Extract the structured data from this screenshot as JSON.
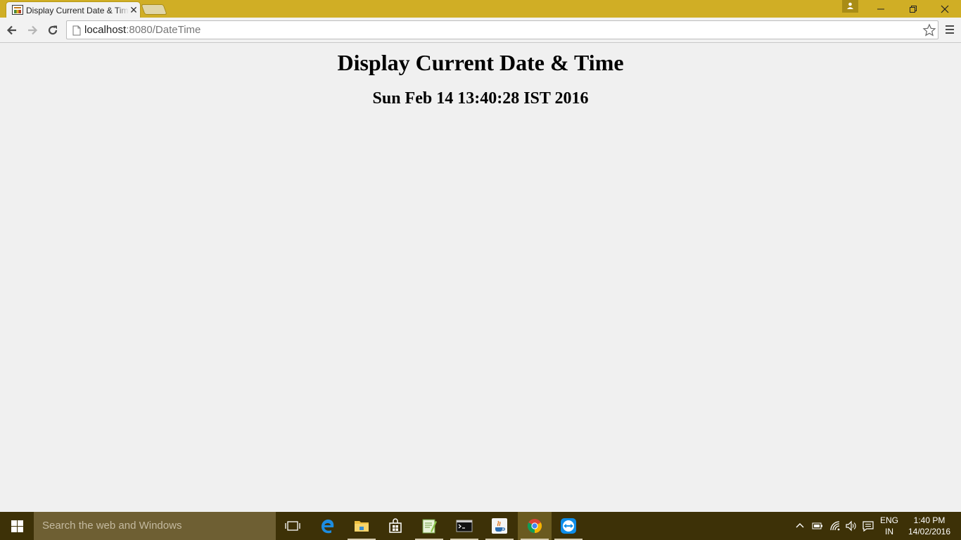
{
  "browser": {
    "tab": {
      "title": "Display Current Date & Time",
      "close_glyph": "✕",
      "favicon": "applet-chart-icon"
    },
    "omnibox": {
      "url_host": "localhost",
      "url_rest": ":8080/DateTime"
    },
    "theme_color": "#d0ae25"
  },
  "page": {
    "heading": "Display Current Date & Time",
    "datetime": "Sun Feb 14 13:40:28 IST 2016"
  },
  "taskbar": {
    "search_placeholder": "Search the web and Windows",
    "apps": [
      "task-view",
      "edge",
      "file-explorer",
      "store",
      "notepad++",
      "command-prompt",
      "java",
      "chrome",
      "teamviewer"
    ],
    "active_app": "chrome",
    "language": {
      "line1": "ENG",
      "line2": "IN"
    },
    "clock": {
      "time": "1:40 PM",
      "date": "14/02/2016"
    }
  }
}
